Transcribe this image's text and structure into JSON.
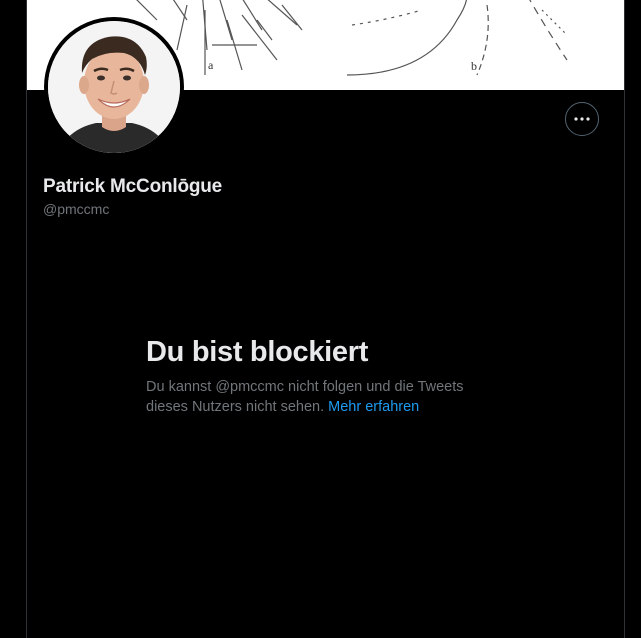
{
  "banner": {
    "label_a": "a",
    "label_b": "b"
  },
  "profile": {
    "display_name": "Patrick McConlōgue",
    "handle": "@pmccmc"
  },
  "blocked": {
    "title": "Du bist blockiert",
    "text": "Du kannst @pmccmc nicht folgen und die Tweets dieses Nutzers nicht sehen.",
    "link": "Mehr erfahren"
  },
  "icons": {
    "more": "more-dots-icon"
  },
  "colors": {
    "background": "#000000",
    "primary_text": "#e7e9ea",
    "secondary_text": "#71767b",
    "link": "#1d9bf0",
    "border": "#2f3336"
  }
}
